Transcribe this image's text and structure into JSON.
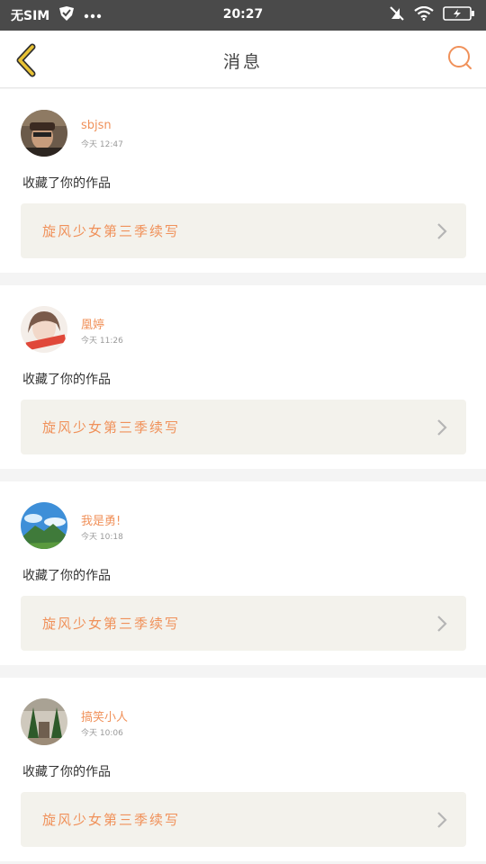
{
  "status_bar": {
    "carrier": "无SIM",
    "time": "20:27",
    "icons": [
      "shield-check-icon",
      "more-dots-icon",
      "mute-icon",
      "wifi-icon",
      "battery-charging-icon"
    ]
  },
  "header": {
    "title": "消息",
    "back_icon": "chevron-left-icon",
    "search_icon": "search-icon"
  },
  "colors": {
    "accent": "#f0915a",
    "back_arrow": "#e8c234",
    "card_work_bg": "#f3f2ec",
    "status_bg": "#4a4a4a"
  },
  "messages": [
    {
      "username": "sbjsn",
      "time": "今天 12:47",
      "action": "收藏了你的作品",
      "work_title": "旋风少女第三季续写"
    },
    {
      "username": "凰婷",
      "time": "今天 11:26",
      "action": "收藏了你的作品",
      "work_title": "旋风少女第三季续写"
    },
    {
      "username": "我是勇!",
      "time": "今天 10:18",
      "action": "收藏了你的作品",
      "work_title": "旋风少女第三季续写"
    },
    {
      "username": "搞笑小人",
      "time": "今天 10:06",
      "action": "收藏了你的作品",
      "work_title": "旋风少女第三季续写"
    }
  ]
}
